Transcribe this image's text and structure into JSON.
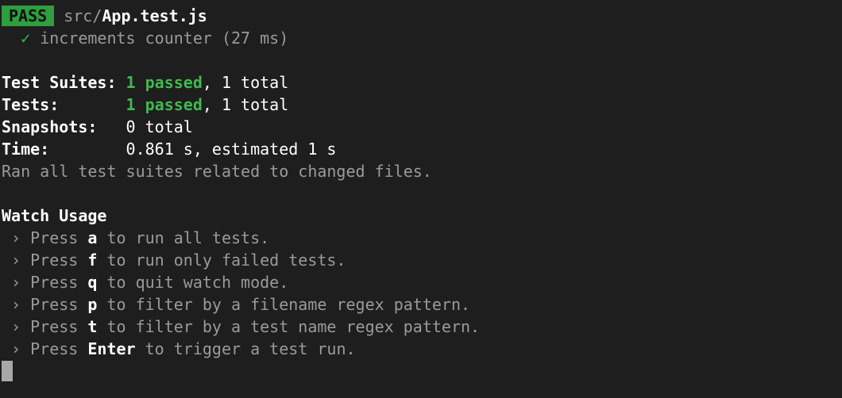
{
  "header": {
    "badge": "PASS",
    "path_dir": "src/",
    "path_file": "App.test.js"
  },
  "test_results": [
    {
      "check": "✓",
      "name": "increments counter (27 ms)"
    }
  ],
  "summary": {
    "suites": {
      "label": "Test Suites:",
      "passed": "1 passed",
      "rest": ", 1 total"
    },
    "tests": {
      "label": "Tests:",
      "passed": "1 passed",
      "rest": ", 1 total"
    },
    "snapshots": {
      "label": "Snapshots:",
      "value": "0 total"
    },
    "time": {
      "label": "Time:",
      "value": "0.861 s, estimated 1 s"
    },
    "note": "Ran all test suites related to changed files."
  },
  "watch": {
    "title": "Watch Usage",
    "items": [
      {
        "prefix": " › Press ",
        "key": "a",
        "suffix": " to run all tests."
      },
      {
        "prefix": " › Press ",
        "key": "f",
        "suffix": " to run only failed tests."
      },
      {
        "prefix": " › Press ",
        "key": "q",
        "suffix": " to quit watch mode."
      },
      {
        "prefix": " › Press ",
        "key": "p",
        "suffix": " to filter by a filename regex pattern."
      },
      {
        "prefix": " › Press ",
        "key": "t",
        "suffix": " to filter by a test name regex pattern."
      },
      {
        "prefix": " › Press ",
        "key": "Enter",
        "suffix": " to trigger a test run."
      }
    ]
  },
  "colors": {
    "background": "#1e1e1e",
    "pass_badge": "#2e9e3e",
    "passed_text": "#3fb950",
    "dim_text": "#9a9a9a"
  }
}
